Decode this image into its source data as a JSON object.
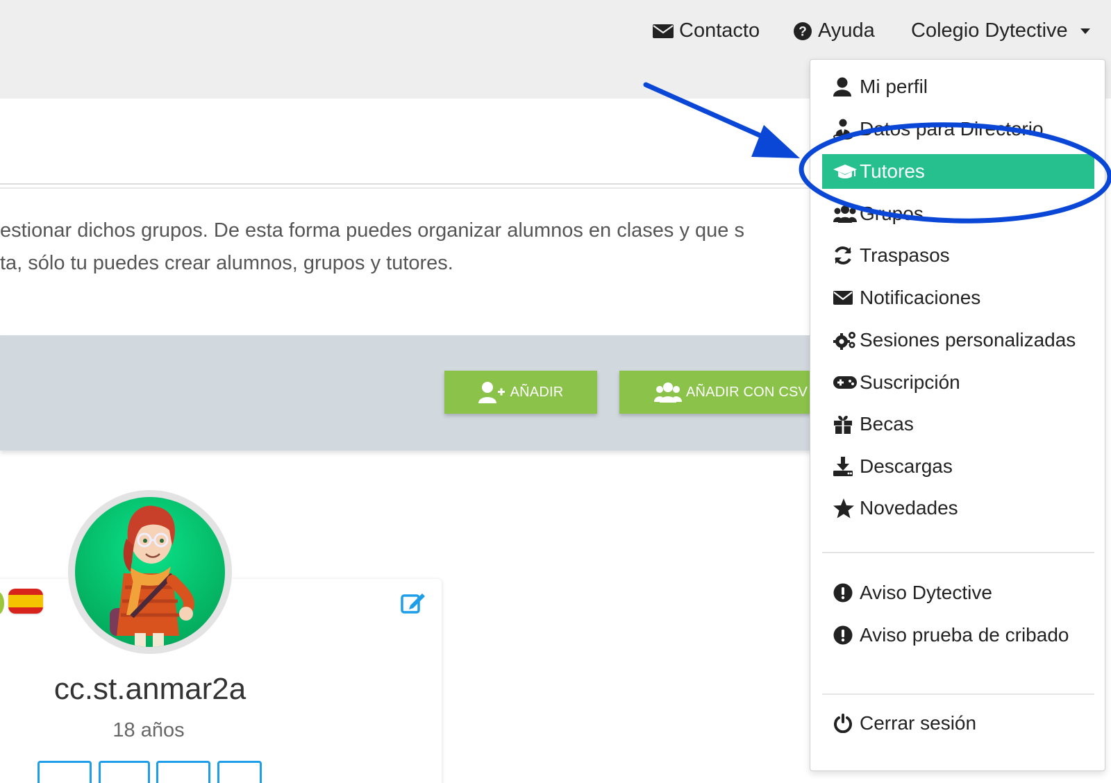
{
  "nav": {
    "contact": "Contacto",
    "help": "Ayuda",
    "account": "Colegio Dytective"
  },
  "intro": {
    "line1": "estionar dichos grupos. De esta forma puedes organizar alumnos en clases y que s",
    "line2": "ta, sólo tu puedes crear alumnos, grupos y tutores."
  },
  "toolbar": {
    "add_label": "AÑADIR",
    "add_csv_label": "AÑADIR CON CSV"
  },
  "student": {
    "name": "cc.st.anmar2a",
    "age": "18 años"
  },
  "dropdown": {
    "items": [
      {
        "label": "Mi perfil",
        "icon": "user-icon"
      },
      {
        "label": "Datos para Directorio",
        "icon": "user-tie-icon"
      },
      {
        "label": "Tutores",
        "icon": "graduation-cap-icon",
        "active": true
      },
      {
        "label": "Grupos",
        "icon": "users-icon"
      },
      {
        "label": "Traspasos",
        "icon": "sync-icon"
      },
      {
        "label": "Notificaciones",
        "icon": "envelope-icon"
      },
      {
        "label": "Sesiones personalizadas",
        "icon": "cogs-icon"
      },
      {
        "label": "Suscripción",
        "icon": "gamepad-icon"
      },
      {
        "label": "Becas",
        "icon": "gift-icon"
      },
      {
        "label": "Descargas",
        "icon": "download-icon"
      },
      {
        "label": "Novedades",
        "icon": "star-icon"
      },
      {
        "label": "Aviso Dytective",
        "icon": "exclamation-circle-icon"
      },
      {
        "label": "Aviso prueba de cribado",
        "icon": "exclamation-circle-icon"
      },
      {
        "label": "Cerrar sesión",
        "icon": "power-off-icon"
      }
    ]
  },
  "colors": {
    "active_item": "#26c08f",
    "add_button": "#8bc34a",
    "annotation": "#0a47d6",
    "toolbar_band": "#d1d8de",
    "topbar": "#eeeeee"
  }
}
